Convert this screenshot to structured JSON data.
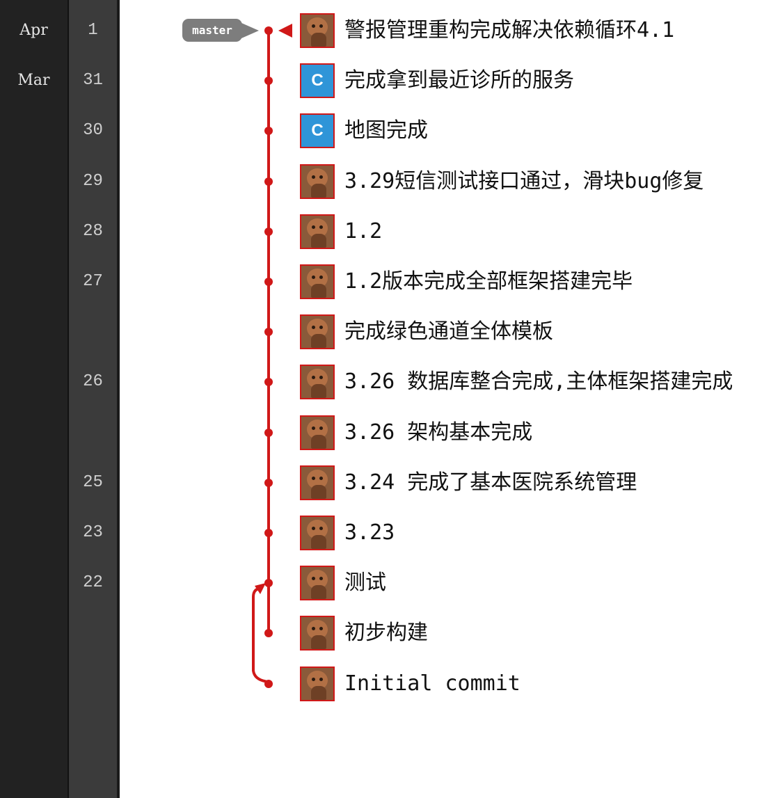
{
  "branch": {
    "label": "master"
  },
  "months": [
    "Apr",
    "Mar"
  ],
  "commits": [
    {
      "day": "1",
      "month": "Apr",
      "avatar": "photo",
      "message": "警报管理重构完成解决依赖循环4.1"
    },
    {
      "day": "31",
      "month": "Mar",
      "avatar": "initial",
      "initial": "C",
      "message": "完成拿到最近诊所的服务"
    },
    {
      "day": "30",
      "month": "",
      "avatar": "initial",
      "initial": "C",
      "message": "地图完成"
    },
    {
      "day": "29",
      "month": "",
      "avatar": "photo",
      "message": "3.29短信测试接口通过，滑块bug修复"
    },
    {
      "day": "28",
      "month": "",
      "avatar": "photo",
      "message": "1.2"
    },
    {
      "day": "27",
      "month": "",
      "avatar": "photo",
      "message": "1.2版本完成全部框架搭建完毕"
    },
    {
      "day": "",
      "month": "",
      "avatar": "photo",
      "message": "完成绿色通道全体模板"
    },
    {
      "day": "26",
      "month": "",
      "avatar": "photo",
      "message": "3.26 数据库整合完成,主体框架搭建完成"
    },
    {
      "day": "",
      "month": "",
      "avatar": "photo",
      "message": "3.26 架构基本完成"
    },
    {
      "day": "25",
      "month": "",
      "avatar": "photo",
      "message": "3.24 完成了基本医院系统管理"
    },
    {
      "day": "23",
      "month": "",
      "avatar": "photo",
      "message": "3.23"
    },
    {
      "day": "22",
      "month": "",
      "avatar": "photo",
      "message": "测试"
    },
    {
      "day": "",
      "month": "",
      "avatar": "photo",
      "message": "初步构建"
    },
    {
      "day": "",
      "month": "",
      "avatar": "photo",
      "message": "Initial commit"
    }
  ],
  "colors": {
    "graph_line": "#d01818",
    "branch_label_bg": "#7d7d7d",
    "month_column_bg": "#222222",
    "day_column_bg": "#3b3b3b",
    "initial_avatar_bg": "#2f95d8"
  },
  "icons": {
    "branch_pointer": "triangle-left-icon",
    "commit_node": "dot-icon",
    "merge_arrow": "arrow-icon"
  }
}
